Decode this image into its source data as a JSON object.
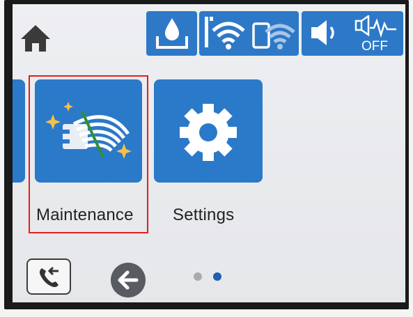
{
  "colors": {
    "accent_blue": "#2b79c9",
    "highlight_red": "#e0201a",
    "dot_active": "#1e5fae",
    "dot_inactive": "#a9abb0"
  },
  "status_bar": {
    "icons": [
      "home-icon",
      "ink-level-icon",
      "wifi-icon",
      "wifi-direct-icon",
      "sound-icon",
      "quiet-mode-icon"
    ],
    "quiet_mode_text": "OFF"
  },
  "tiles": [
    {
      "label": "Maintenance",
      "icon": "maintenance-icon",
      "highlighted": true
    },
    {
      "label": "Settings",
      "icon": "gear-icon",
      "highlighted": false
    }
  ],
  "navigation": {
    "page_count": 2,
    "current_page": 2
  }
}
